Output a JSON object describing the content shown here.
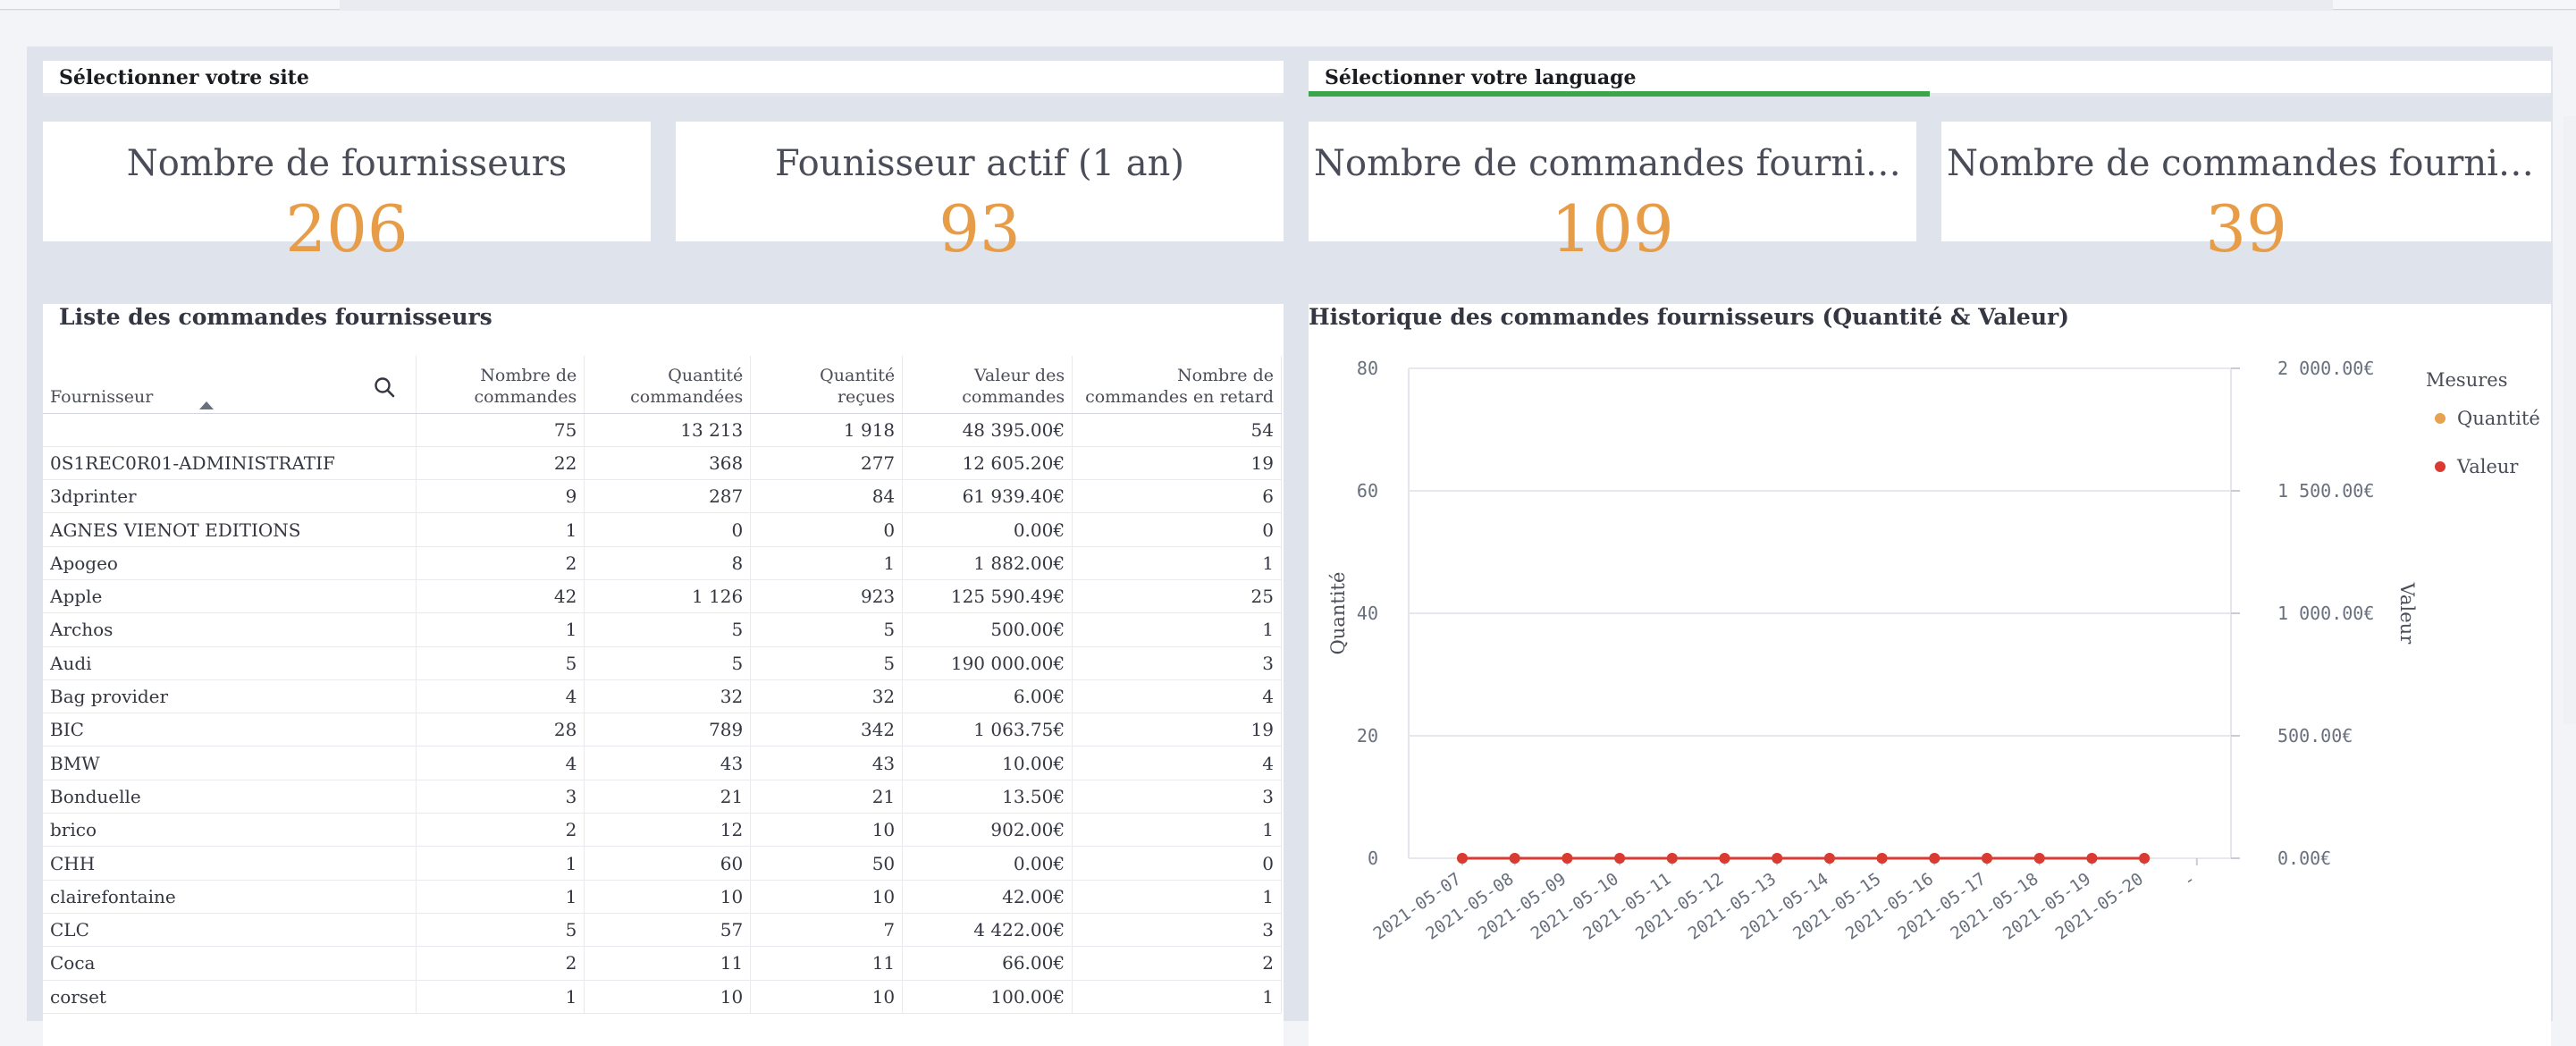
{
  "controls": {
    "site": {
      "title": "Sélectionner votre site"
    },
    "language": {
      "title": "Sélectionner votre language",
      "progress": 0.5
    }
  },
  "metrics": [
    {
      "label": "Nombre de fournisseurs",
      "value": "206"
    },
    {
      "label": "Founisseur actif (1 an)",
      "value": "93"
    },
    {
      "label": "Nombre de commandes fournisseu…",
      "value": "109"
    },
    {
      "label": "Nombre de commandes fournisseu…",
      "value": "39"
    }
  ],
  "supplier_table": {
    "title": "Liste des commandes fournisseurs",
    "columns": [
      "Fournisseur",
      "Nombre de commandes",
      "Quantité commandées",
      "Quantité reçues",
      "Valeur des commandes",
      "Nombre de commandes en retard"
    ],
    "totals": [
      "",
      "75",
      "13 213",
      "1 918",
      "48 395.00€",
      "54"
    ],
    "rows": [
      [
        "0S1REC0R01-ADMINISTRATIF",
        "22",
        "368",
        "277",
        "12 605.20€",
        "19"
      ],
      [
        "3dprinter",
        "9",
        "287",
        "84",
        "61 939.40€",
        "6"
      ],
      [
        "AGNES VIENOT EDITIONS",
        "1",
        "0",
        "0",
        "0.00€",
        "0"
      ],
      [
        "Apogeo",
        "2",
        "8",
        "1",
        "1 882.00€",
        "1"
      ],
      [
        "Apple",
        "42",
        "1 126",
        "923",
        "125 590.49€",
        "25"
      ],
      [
        "Archos",
        "1",
        "5",
        "5",
        "500.00€",
        "1"
      ],
      [
        "Audi",
        "5",
        "5",
        "5",
        "190 000.00€",
        "3"
      ],
      [
        "Bag provider",
        "4",
        "32",
        "32",
        "6.00€",
        "4"
      ],
      [
        "BIC",
        "28",
        "789",
        "342",
        "1 063.75€",
        "19"
      ],
      [
        "BMW",
        "4",
        "43",
        "43",
        "10.00€",
        "4"
      ],
      [
        "Bonduelle",
        "3",
        "21",
        "21",
        "13.50€",
        "3"
      ],
      [
        "brico",
        "2",
        "12",
        "10",
        "902.00€",
        "1"
      ],
      [
        "CHH",
        "1",
        "60",
        "50",
        "0.00€",
        "0"
      ],
      [
        "clairefontaine",
        "1",
        "10",
        "10",
        "42.00€",
        "1"
      ],
      [
        "CLC",
        "5",
        "57",
        "7",
        "4 422.00€",
        "3"
      ],
      [
        "Coca",
        "2",
        "11",
        "11",
        "66.00€",
        "2"
      ],
      [
        "corset",
        "1",
        "10",
        "10",
        "100.00€",
        "1"
      ]
    ]
  },
  "chart_data": {
    "type": "line",
    "title": "Historique des commandes fournisseurs (Quantité & Valeur)",
    "x": [
      "2021-05-07",
      "2021-05-08",
      "2021-05-09",
      "2021-05-10",
      "2021-05-11",
      "2021-05-12",
      "2021-05-13",
      "2021-05-14",
      "2021-05-15",
      "2021-05-16",
      "2021-05-17",
      "2021-05-18",
      "2021-05-19",
      "2021-05-20",
      "-"
    ],
    "xlabel": "",
    "y_left": {
      "label": "Quantité",
      "range": [
        0,
        80
      ],
      "ticks": [
        "0",
        "20",
        "40",
        "60",
        "80"
      ]
    },
    "y_right": {
      "label": "Valeur",
      "range": [
        0,
        2000
      ],
      "ticks": [
        "0.00€",
        "500.00€",
        "1 000.00€",
        "1 500.00€",
        "2 000.00€"
      ]
    },
    "series": [
      {
        "name": "Quantité",
        "axis": "left",
        "color": "#e7a24d",
        "values": [
          0,
          0,
          0,
          0,
          0,
          0,
          0,
          0,
          0,
          0,
          0,
          0,
          0,
          0
        ]
      },
      {
        "name": "Valeur",
        "axis": "right",
        "color": "#d93a32",
        "values": [
          0,
          0,
          0,
          0,
          0,
          0,
          0,
          0,
          0,
          0,
          0,
          0,
          0,
          0
        ]
      }
    ],
    "legend": {
      "title": "Mesures",
      "placement": "top-right"
    },
    "grid": true
  }
}
